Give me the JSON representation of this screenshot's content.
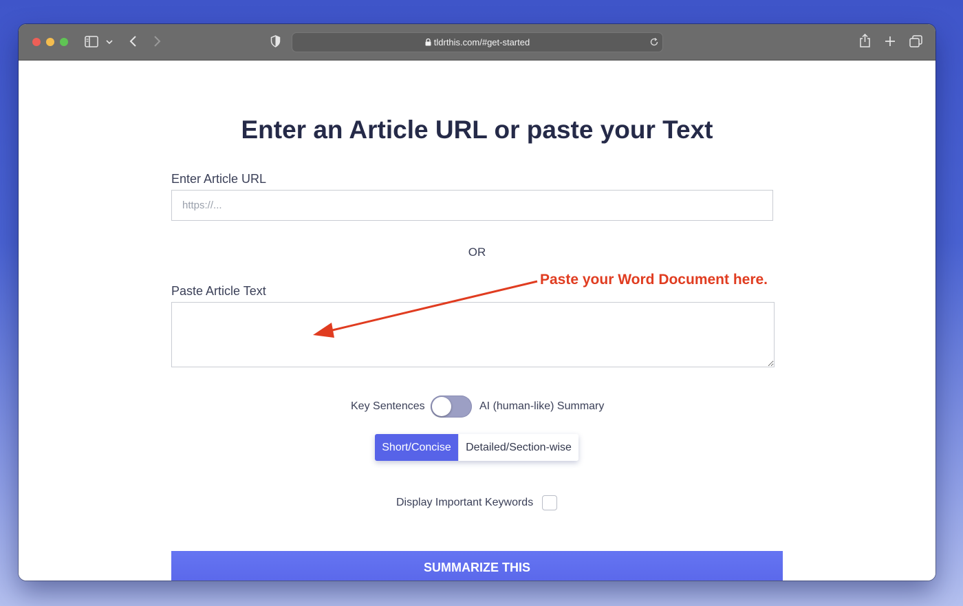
{
  "browser": {
    "url": "tldrthis.com/#get-started",
    "traffic_lights": {
      "close": "#ed5f57",
      "minimize": "#f4bd4f",
      "maximize": "#5fc454"
    }
  },
  "page": {
    "title": "Enter an Article URL or paste your Text",
    "url_label": "Enter Article URL",
    "url_placeholder": "https://...",
    "url_value": "",
    "or_text": "OR",
    "text_label": "Paste Article Text",
    "text_value": "",
    "annotation": "Paste your Word Document here.",
    "toggle": {
      "left_label": "Key Sentences",
      "right_label": "AI (human-like) Summary",
      "state": "off"
    },
    "length_options": [
      "Short/Concise",
      "Detailed/Section-wise"
    ],
    "length_selected": "Short/Concise",
    "keywords_label": "Display Important Keywords",
    "keywords_checked": false,
    "submit_label": "SUMMARIZE THIS"
  },
  "colors": {
    "accent": "#5a67ea",
    "heading": "#252a48",
    "annotation": "#e03c20"
  }
}
